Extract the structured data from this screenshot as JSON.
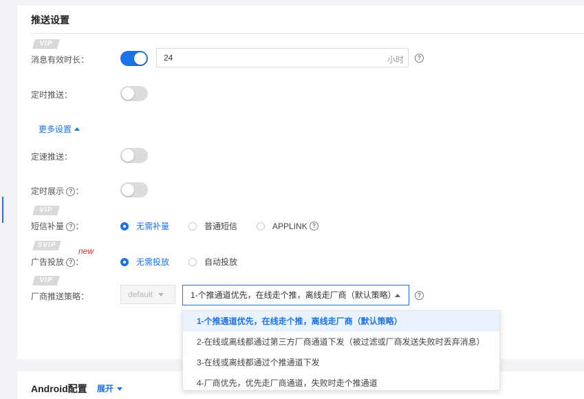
{
  "section": {
    "title": "推送设置"
  },
  "badges": {
    "vip": "VIP",
    "svip": "SVIP"
  },
  "validity": {
    "label": "消息有效时长：",
    "enabled": true,
    "value": "24",
    "unit": "小时",
    "help": "?"
  },
  "scheduled_push": {
    "label": "定时推送：",
    "enabled": false
  },
  "more_settings": {
    "label": "更多设置"
  },
  "rate_push": {
    "label": "定速推送：",
    "enabled": false
  },
  "scheduled_display": {
    "label": "定时展示",
    "help": "?",
    "suffix": "：",
    "enabled": false
  },
  "sms": {
    "label": "短信补量",
    "help": "?",
    "suffix": "：",
    "options": [
      "无需补量",
      "普通短信",
      "APPLINK"
    ],
    "selected": "无需补量"
  },
  "ads": {
    "label": "广告投放",
    "help": "?",
    "suffix": "：",
    "new_tag": "new",
    "options": [
      "无需投放",
      "自动投放"
    ],
    "selected": "无需投放"
  },
  "vendor_strategy": {
    "label": "厂商推送策略：",
    "small_select": "default",
    "selected": "1-个推通道优先，在线走个推，离线走厂商（默认策略）",
    "help": "?",
    "options": [
      "1-个推通道优先，在线走个推，离线走厂商（默认策略）",
      "2-在线或离线都通过第三方厂商通道下发（被过滤或厂商发送失败时丢弃消息）",
      "3-在线或离线都通过个推通道下发",
      "4-厂商优先，优先走厂商通道，失败时走个推通道"
    ]
  },
  "android": {
    "title": "Android配置",
    "expand": "展开"
  },
  "colors": {
    "accent": "#1a73e8",
    "new_tag": "#d32f2f"
  }
}
